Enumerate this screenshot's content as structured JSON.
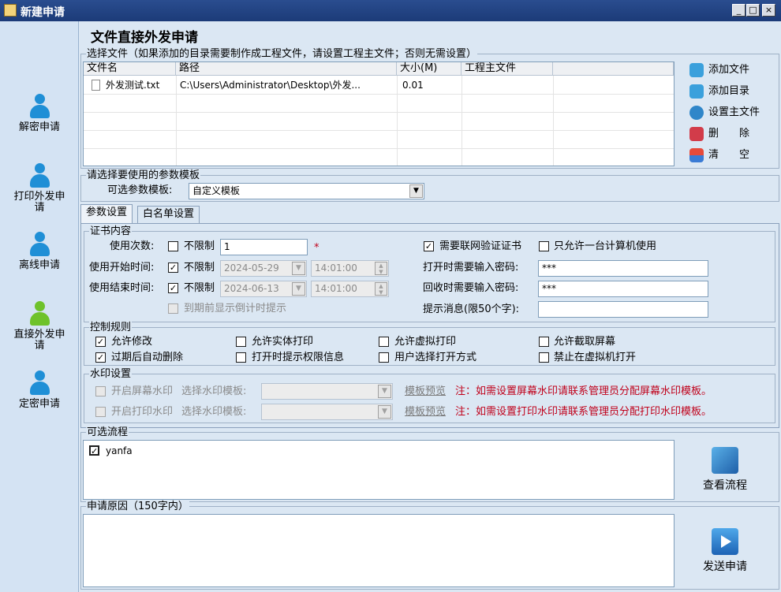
{
  "window": {
    "title": "新建申请",
    "min": "_",
    "max": "□",
    "close": "×"
  },
  "sidebar": {
    "items": [
      {
        "label": "解密申请"
      },
      {
        "label": "打印外发申请"
      },
      {
        "label": "离线申请"
      },
      {
        "label": "直接外发申请"
      },
      {
        "label": "定密申请"
      }
    ]
  },
  "main": {
    "title": "文件直接外发申请",
    "files": {
      "legend": "选择文件（如果添加的目录需要制作成工程文件，请设置工程主文件；否则无需设置）",
      "columns": [
        "文件名",
        "路径",
        "大小(M)",
        "工程主文件"
      ],
      "rows": [
        {
          "name": "外发测试.txt",
          "path": "C:\\Users\\Administrator\\Desktop\\外发...",
          "size": "0.01",
          "main": ""
        }
      ],
      "buttons": {
        "add_file": "添加文件",
        "add_dir": "添加目录",
        "set_main": "设置主文件",
        "delete": "删　　除",
        "clear": "清　　空"
      }
    },
    "template": {
      "legend": "请选择要使用的参数模板",
      "label": "可选参数模板:",
      "value": "自定义模板"
    },
    "tabs": [
      "参数设置",
      "白名单设置"
    ],
    "cert": {
      "legend": "证书内容",
      "use_count_label": "使用次数:",
      "unlimited": "不限制",
      "use_count_value": "1",
      "required_mark": "*",
      "start_label": "使用开始时间:",
      "start_date": "2024-05-29",
      "start_time": "14:01:00",
      "end_label": "使用结束时间:",
      "end_date": "2024-06-13",
      "end_time": "14:01:00",
      "countdown": "到期前显示倒计时提示",
      "net_verify": "需要联网验证证书",
      "one_pc": "只允许一台计算机使用",
      "open_pwd_label": "打开时需要输入密码:",
      "open_pwd": "***",
      "recycle_pwd_label": "回收时需要输入密码:",
      "recycle_pwd": "***",
      "tip_label": "提示消息(限50个字):",
      "tip_value": ""
    },
    "control": {
      "legend": "控制规则",
      "items": [
        {
          "label": "允许修改",
          "checked": true
        },
        {
          "label": "允许实体打印",
          "checked": false
        },
        {
          "label": "允许虚拟打印",
          "checked": false
        },
        {
          "label": "允许截取屏幕",
          "checked": false
        },
        {
          "label": "过期后自动删除",
          "checked": true
        },
        {
          "label": "打开时提示权限信息",
          "checked": false
        },
        {
          "label": "用户选择打开方式",
          "checked": false
        },
        {
          "label": "禁止在虚拟机打开",
          "checked": false
        }
      ]
    },
    "watermark": {
      "legend": "水印设置",
      "screen": "开启屏幕水印",
      "print": "开启打印水印",
      "choose": "选择水印模板:",
      "preview": "模板预览",
      "screen_note": "注：如需设置屏幕水印请联系管理员分配屏幕水印模板。",
      "print_note": "注：如需设置打印水印请联系管理员分配打印水印模板。"
    },
    "flow": {
      "legend": "可选流程",
      "items": [
        "yanfa"
      ],
      "view_button": "查看流程"
    },
    "reason": {
      "legend": "申请原因（150字内）",
      "send_button": "发送申请"
    }
  },
  "colors": {
    "titlebar": "#1c3b78",
    "background": "#dbe7f3",
    "note": "#c0001a"
  }
}
